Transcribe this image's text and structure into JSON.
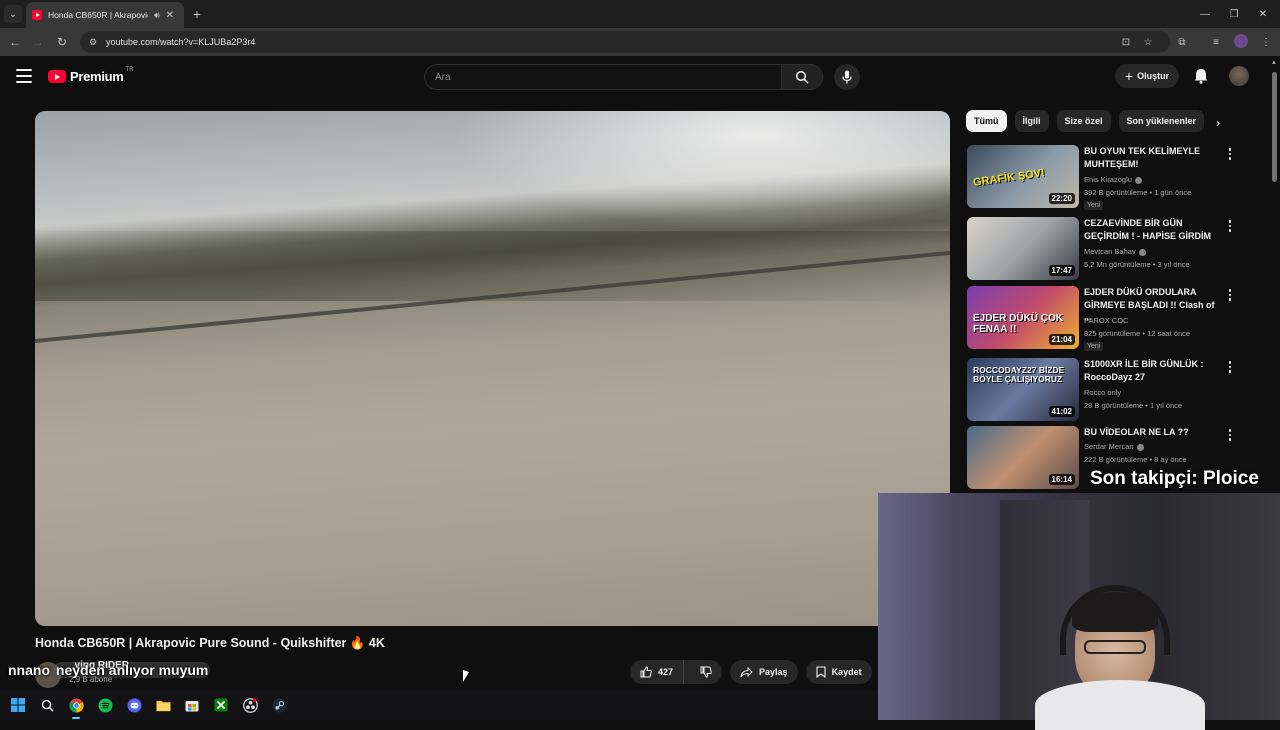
{
  "browser": {
    "tab_title": "Honda CB650R | Akrapovic",
    "url": "youtube.com/watch?v=KLJUBa2P3r4"
  },
  "header": {
    "logo_text": "Premium",
    "logo_country": "TR",
    "search_placeholder": "Ara",
    "create_label": "Oluştur"
  },
  "video": {
    "title": "Honda CB650R | Akrapovic Pure Sound - Quikshifter 🔥 4K",
    "channel_name": "_ving RIDER",
    "channel_subs": "2,9 B abone",
    "like_count": "427",
    "share_label": "Paylaş",
    "save_label": "Kaydet"
  },
  "chat_overlay": {
    "prefix": "nnano ",
    "text": "neyden anlıyor muyum"
  },
  "chips": [
    {
      "label": "Tümü",
      "active": true
    },
    {
      "label": "İlgili",
      "active": false
    },
    {
      "label": "Size özel",
      "active": false
    },
    {
      "label": "Son yüklenenler",
      "active": false
    }
  ],
  "recommendations": [
    {
      "title": "BU OYUN TEK KELİMEYLE MUHTEŞEM!",
      "channel": "Enis Kirazoglu",
      "verified": true,
      "meta": "392 B görüntüleme • 1 gün önce",
      "badge": "Yeni",
      "duration": "22:20",
      "thumb_text": "GRAFİK ŞOV!"
    },
    {
      "title": "CEZAEVİNDE BİR GÜN GEÇİRDİM ! - HAPİSE GİRDİM",
      "channel": "Mevtcan Bahav",
      "verified": true,
      "meta": "5,2 Mn görüntüleme • 3 yıl önce",
      "badge": "",
      "duration": "17:47",
      "thumb_text": ""
    },
    {
      "title": "EJDER DÜKÜ ORDULARA GİRMEYE BAŞLADI !! Clash of ...",
      "channel": "PAROX COC",
      "verified": false,
      "meta": "825 görüntüleme • 12 saat önce",
      "badge": "Yeni",
      "duration": "21:04",
      "thumb_text": "EJDER DÜKÜ ÇOK FENAA !!"
    },
    {
      "title": "S1000XR İLE BİR GÜNLÜK : RoccoDayz 27",
      "channel": "Rocco only",
      "verified": false,
      "meta": "28 B görüntüleme • 1 yıl önce",
      "badge": "",
      "duration": "41:02",
      "thumb_text": "ROCCODAYZ27 BİZDE BÖYLE ÇALIŞIYORUZ"
    },
    {
      "title": "BU VİDEOLAR NE LA ??",
      "channel": "Serdar Mercan",
      "verified": true,
      "meta": "222 B görüntüleme • 8 ay önce",
      "badge": "",
      "duration": "16:14",
      "thumb_text": ""
    }
  ],
  "stream_overlay": {
    "follower_banner": "Son takipçi: Ploice"
  },
  "icons": {
    "tab_list": "chevron-down-icon",
    "back": "back-arrow-icon",
    "forward": "forward-arrow-icon",
    "reload": "reload-icon",
    "search": "search-icon",
    "mic": "mic-icon",
    "bell": "bell-icon"
  },
  "colors": {
    "youtube_red": "#ff0033",
    "background": "#0f0f0f",
    "chip_active": "#f1f1f1"
  }
}
